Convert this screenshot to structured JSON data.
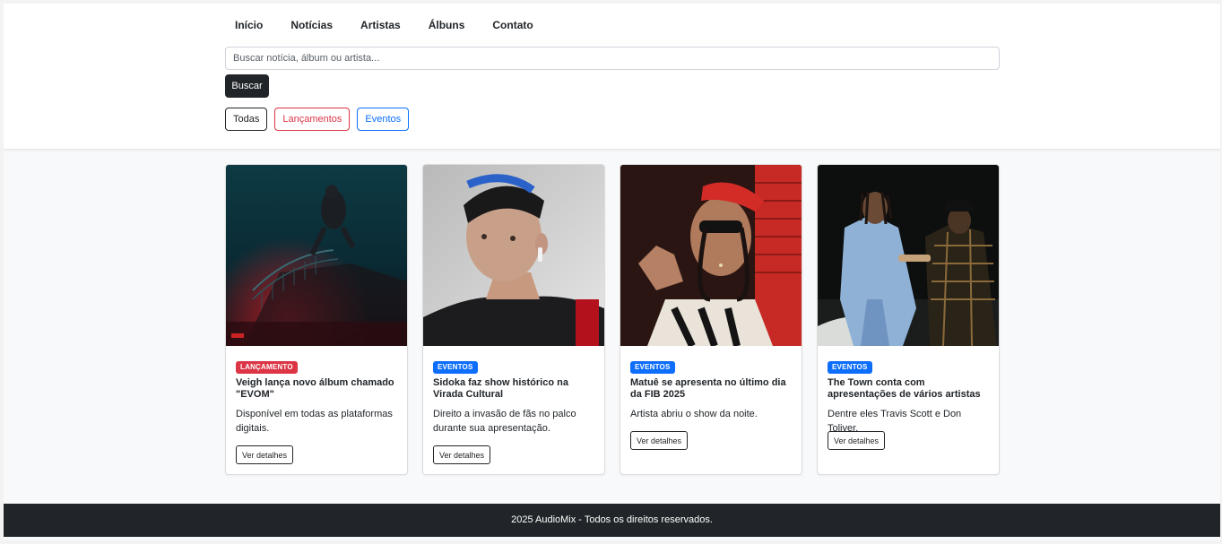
{
  "nav": {
    "items": [
      "Início",
      "Notícias",
      "Artistas",
      "Álbuns",
      "Contato"
    ]
  },
  "search": {
    "placeholder": "Buscar notícia, álbum ou artista...",
    "button_label": "Buscar"
  },
  "filters": [
    "Todas",
    "Lançamentos",
    "Eventos"
  ],
  "colors": {
    "dark": "#212529",
    "launch_red": "#dc3545",
    "event_blue": "#0d6efd",
    "page_bg": "#f8f9fa"
  },
  "cards": [
    {
      "badge": "LANÇAMENTO",
      "badge_color": "#dc3545",
      "title": "Veigh lança novo álbum chamado \"EVOM\"",
      "text": "Disponível em todas as plataformas digitais.",
      "button": "Ver detalhes"
    },
    {
      "badge": "EVENTOS",
      "badge_color": "#0d6efd",
      "title": "Sidoka faz show histórico na Virada Cultural",
      "text": "Direito a invasão de fãs no palco durante sua apresentação.",
      "button": "Ver detalhes"
    },
    {
      "badge": "EVENTOS",
      "badge_color": "#0d6efd",
      "title": "Matuê se apresenta no último dia da FIB 2025",
      "text": "Artista abriu o show da noite.",
      "button": "Ver detalhes"
    },
    {
      "badge": "EVENTOS",
      "badge_color": "#0d6efd",
      "title": "The Town conta com apresentações de vários artistas",
      "text": "Dentre eles Travis Scott e Don Toliver.",
      "button": "Ver detalhes"
    }
  ],
  "footer": {
    "text": "2025 AudioMix - Todos os direitos reservados."
  }
}
